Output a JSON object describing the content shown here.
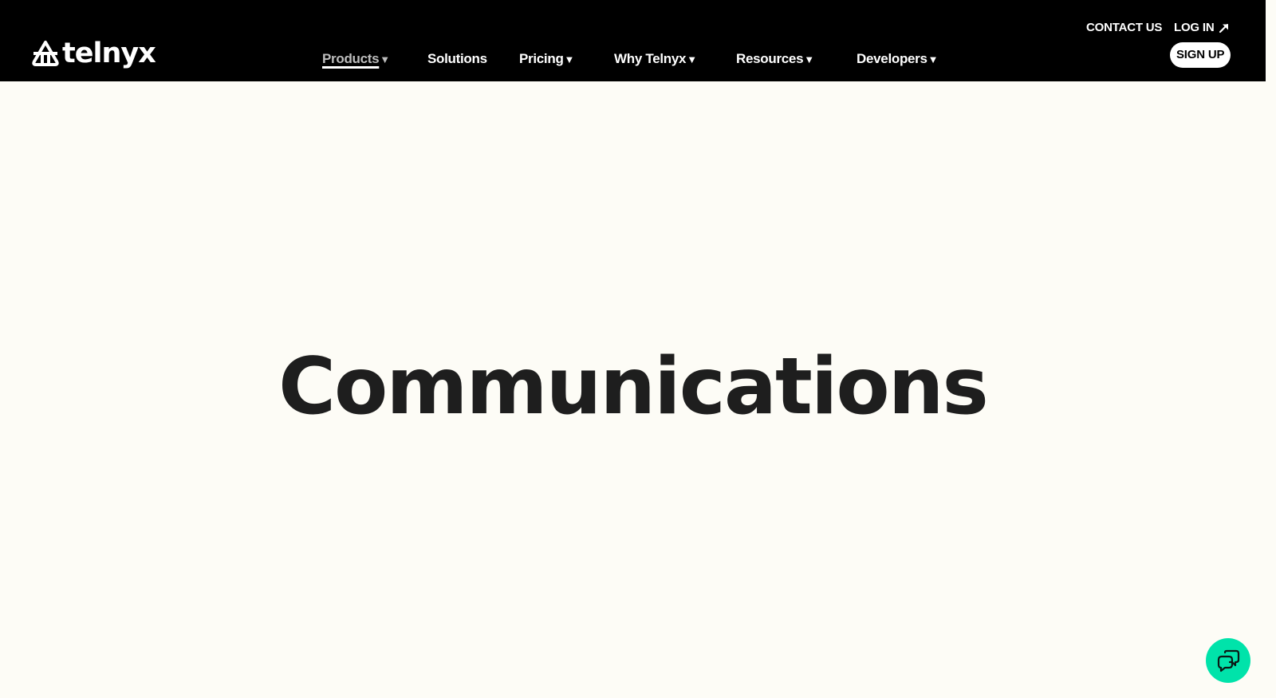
{
  "header": {
    "logo_text": "telnyx",
    "logo_icon": "telnyx-logo-mark",
    "utility_links": {
      "contact": "CONTACT US",
      "login": "LOG IN",
      "login_icon": "arrow-up-right-icon"
    },
    "signup_label": "SIGN UP",
    "nav": [
      {
        "label": "Products",
        "caret": "▼",
        "active": true
      },
      {
        "label": "Solutions",
        "caret": ""
      },
      {
        "label": "Pricing",
        "caret": "▼"
      },
      {
        "label": "Why Telnyx",
        "caret": "▼"
      },
      {
        "label": "Resources",
        "caret": "▼"
      },
      {
        "label": "Developers",
        "caret": "▼"
      }
    ]
  },
  "hero": {
    "title": "Communications"
  },
  "chat_widget": {
    "icon": "chat-bubbles-icon"
  },
  "colors": {
    "header_bg": "#000000",
    "page_bg": "#FDFCF6",
    "accent": "#00E3AA",
    "title_text": "#1E1E1E"
  }
}
